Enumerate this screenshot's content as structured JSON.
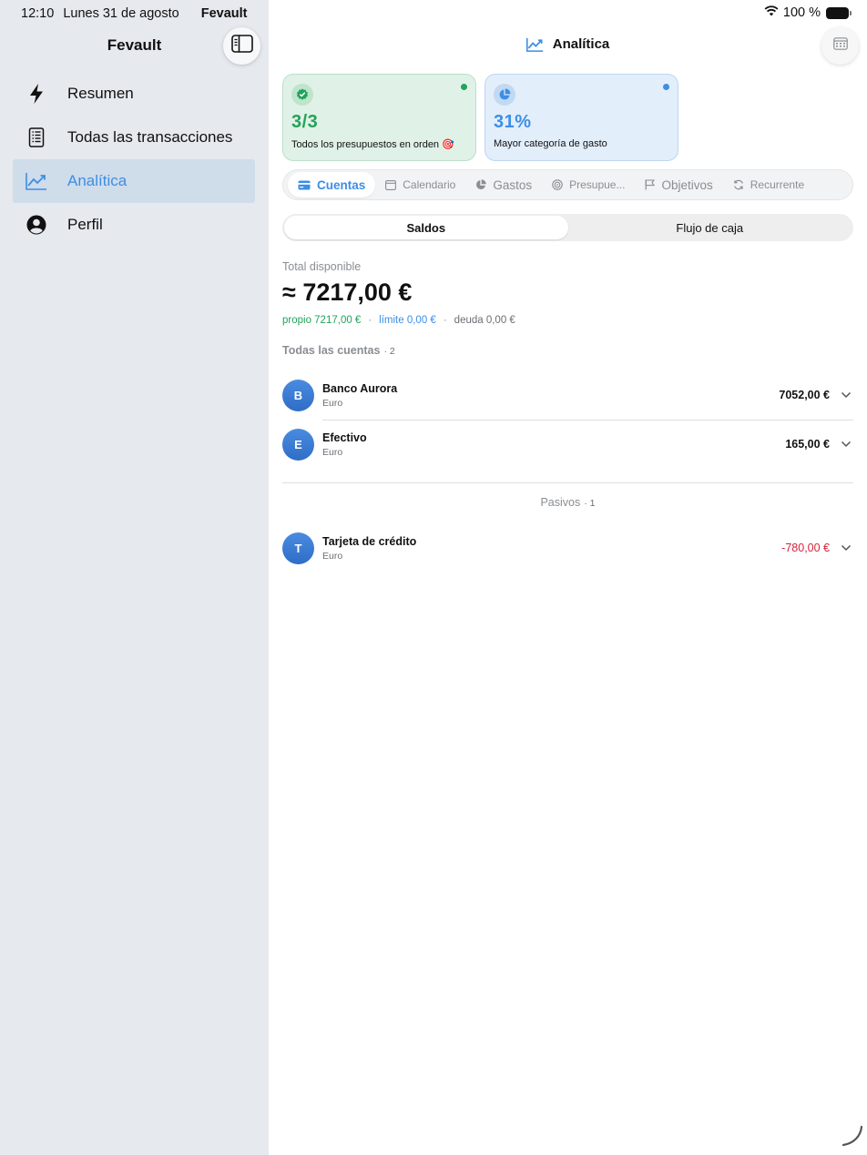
{
  "status_bar": {
    "time": "12:10",
    "date": "Lunes 31 de agosto",
    "app_name": "Fevault",
    "battery_pct": "100 %"
  },
  "sidebar": {
    "title": "Fevault",
    "items": [
      {
        "label": "Resumen",
        "icon": "bolt-icon"
      },
      {
        "label": "Todas las transacciones",
        "icon": "receipt-icon"
      },
      {
        "label": "Analítica",
        "icon": "chart-line-icon",
        "active": true
      },
      {
        "label": "Perfil",
        "icon": "person-circle-icon"
      }
    ]
  },
  "header": {
    "title": "Analítica"
  },
  "cards": {
    "budgets": {
      "value": "3/3",
      "caption": "Todos los presupuestos en orden 🎯",
      "color": "#22a35a"
    },
    "category": {
      "value": "31%",
      "caption": "Mayor categoría de gasto",
      "color": "#3d8ee5"
    }
  },
  "tabs": [
    {
      "label": "Cuentas",
      "icon": "card-icon",
      "active": true
    },
    {
      "label": "Calendario",
      "icon": "calendar-icon"
    },
    {
      "label": "Gastos",
      "icon": "pie-icon"
    },
    {
      "label": "Presupue...",
      "icon": "target-icon"
    },
    {
      "label": "Objetivos",
      "icon": "flag-icon"
    },
    {
      "label": "Recurrente",
      "icon": "repeat-icon"
    }
  ],
  "segmented": {
    "balances": "Saldos",
    "cashflow": "Flujo de caja",
    "selected": "Saldos"
  },
  "summary": {
    "label": "Total disponible",
    "amount": "≈ 7217,00 €",
    "own": "propio 7217,00 €",
    "limit": "límite 0,00 €",
    "debt": "deuda 0,00 €",
    "separator": "·"
  },
  "accounts_section": {
    "title": "Todas las cuentas",
    "count": "· 2",
    "items": [
      {
        "initial": "B",
        "name": "Banco Aurora",
        "currency": "Euro",
        "amount": "7052,00 €"
      },
      {
        "initial": "E",
        "name": "Efectivo",
        "currency": "Euro",
        "amount": "165,00 €"
      }
    ]
  },
  "liabilities_section": {
    "title": "Pasivos",
    "count": "· 1",
    "items": [
      {
        "initial": "T",
        "name": "Tarjeta de crédito",
        "currency": "Euro",
        "amount": "-780,00 €"
      }
    ]
  },
  "colors": {
    "accent": "#3d8ee5",
    "positive": "#22a35a",
    "negative": "#d6243a",
    "sidebar_bg": "#e6e9ed",
    "active_nav_bg": "#cfdcea"
  }
}
